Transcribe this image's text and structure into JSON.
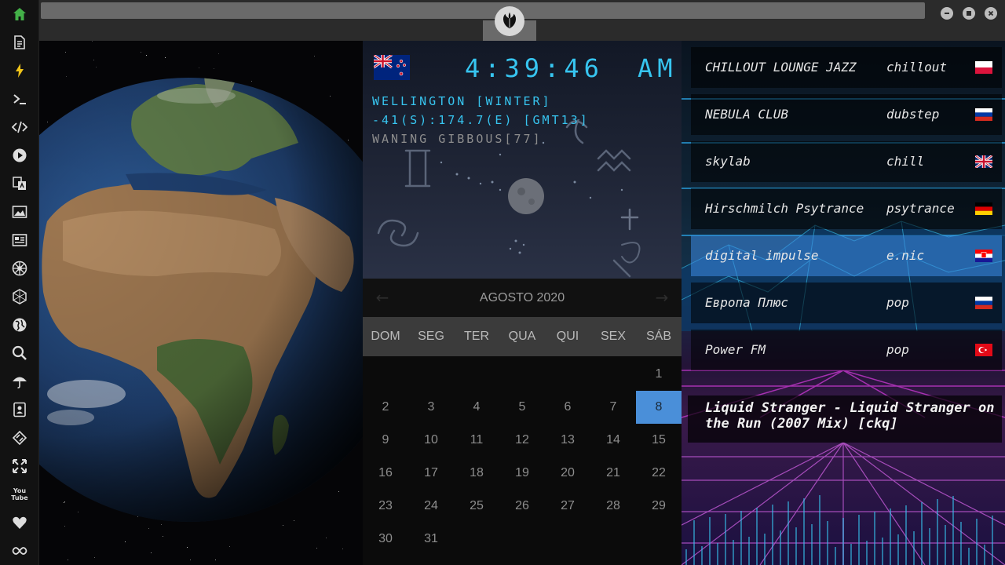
{
  "sidebar": {
    "items": [
      {
        "icon": "home-icon",
        "color": "#43b048"
      },
      {
        "icon": "document-icon"
      },
      {
        "icon": "lightning-icon",
        "color": "#f0c419"
      },
      {
        "icon": "terminal-icon"
      },
      {
        "icon": "code-icon"
      },
      {
        "icon": "play-icon"
      },
      {
        "icon": "translate-icon"
      },
      {
        "icon": "image-icon"
      },
      {
        "icon": "news-icon"
      },
      {
        "icon": "galactic-empire-icon"
      },
      {
        "icon": "hexagon-icon"
      },
      {
        "icon": "globe-icon"
      },
      {
        "icon": "search-icon"
      },
      {
        "icon": "umbrella-icon"
      },
      {
        "icon": "contacts-icon"
      },
      {
        "icon": "tag-icon"
      },
      {
        "icon": "expand-icon"
      },
      {
        "icon": "youtube-icon",
        "text": "You Tube"
      },
      {
        "icon": "heart-icon"
      },
      {
        "icon": "infinity-icon"
      }
    ]
  },
  "window": {
    "logo_icon": "rebel-alliance-icon",
    "controls": [
      "minimize-icon",
      "maximize-icon",
      "close-icon"
    ]
  },
  "clock": {
    "time": "4:39:46",
    "ampm": "AM",
    "location": "WELLINGTON [WINTER]",
    "coords": "-41(S):174.7(E) [GMT13]",
    "moon": "WANING GIBBOUS[77]",
    "flag_icon": "new-zealand-flag-icon",
    "accent_color": "#37c5f0"
  },
  "calendar": {
    "month": "AGOSTO 2020",
    "weekdays": [
      "DOM",
      "SEG",
      "TER",
      "QUA",
      "QUI",
      "SEX",
      "SÁB"
    ],
    "days": [
      "1",
      "2",
      "3",
      "4",
      "5",
      "6",
      "7",
      "8",
      "9",
      "10",
      "11",
      "12",
      "13",
      "14",
      "15",
      "16",
      "17",
      "18",
      "19",
      "20",
      "21",
      "22",
      "23",
      "24",
      "25",
      "26",
      "27",
      "28",
      "29",
      "30",
      "31"
    ],
    "first_weekday": 6,
    "today": "8",
    "today_color": "#4a8fd9"
  },
  "radio": {
    "stations": [
      {
        "name": "CHILLOUT LOUNGE JAZZ",
        "genre": "chillout",
        "flag": "poland-flag-icon"
      },
      {
        "name": "NEBULA CLUB",
        "genre": "dubstep",
        "flag": "russia-flag-icon"
      },
      {
        "name": "skylab",
        "genre": "chill",
        "flag": "uk-flag-icon"
      },
      {
        "name": "Hirschmilch Psytrance",
        "genre": "psytrance",
        "flag": "germany-flag-icon"
      },
      {
        "name": "digital impulse",
        "genre": "e.nic",
        "flag": "croatia-flag-icon"
      },
      {
        "name": "Европа Плюс",
        "genre": "pop",
        "flag": "russia-flag-icon"
      },
      {
        "name": "Power FM",
        "genre": "pop",
        "flag": "turkey-flag-icon"
      }
    ],
    "active_index": 4,
    "now_playing": "Liquid Stranger - Liquid Stranger on the Run (2007 Mix) [ckq]"
  }
}
